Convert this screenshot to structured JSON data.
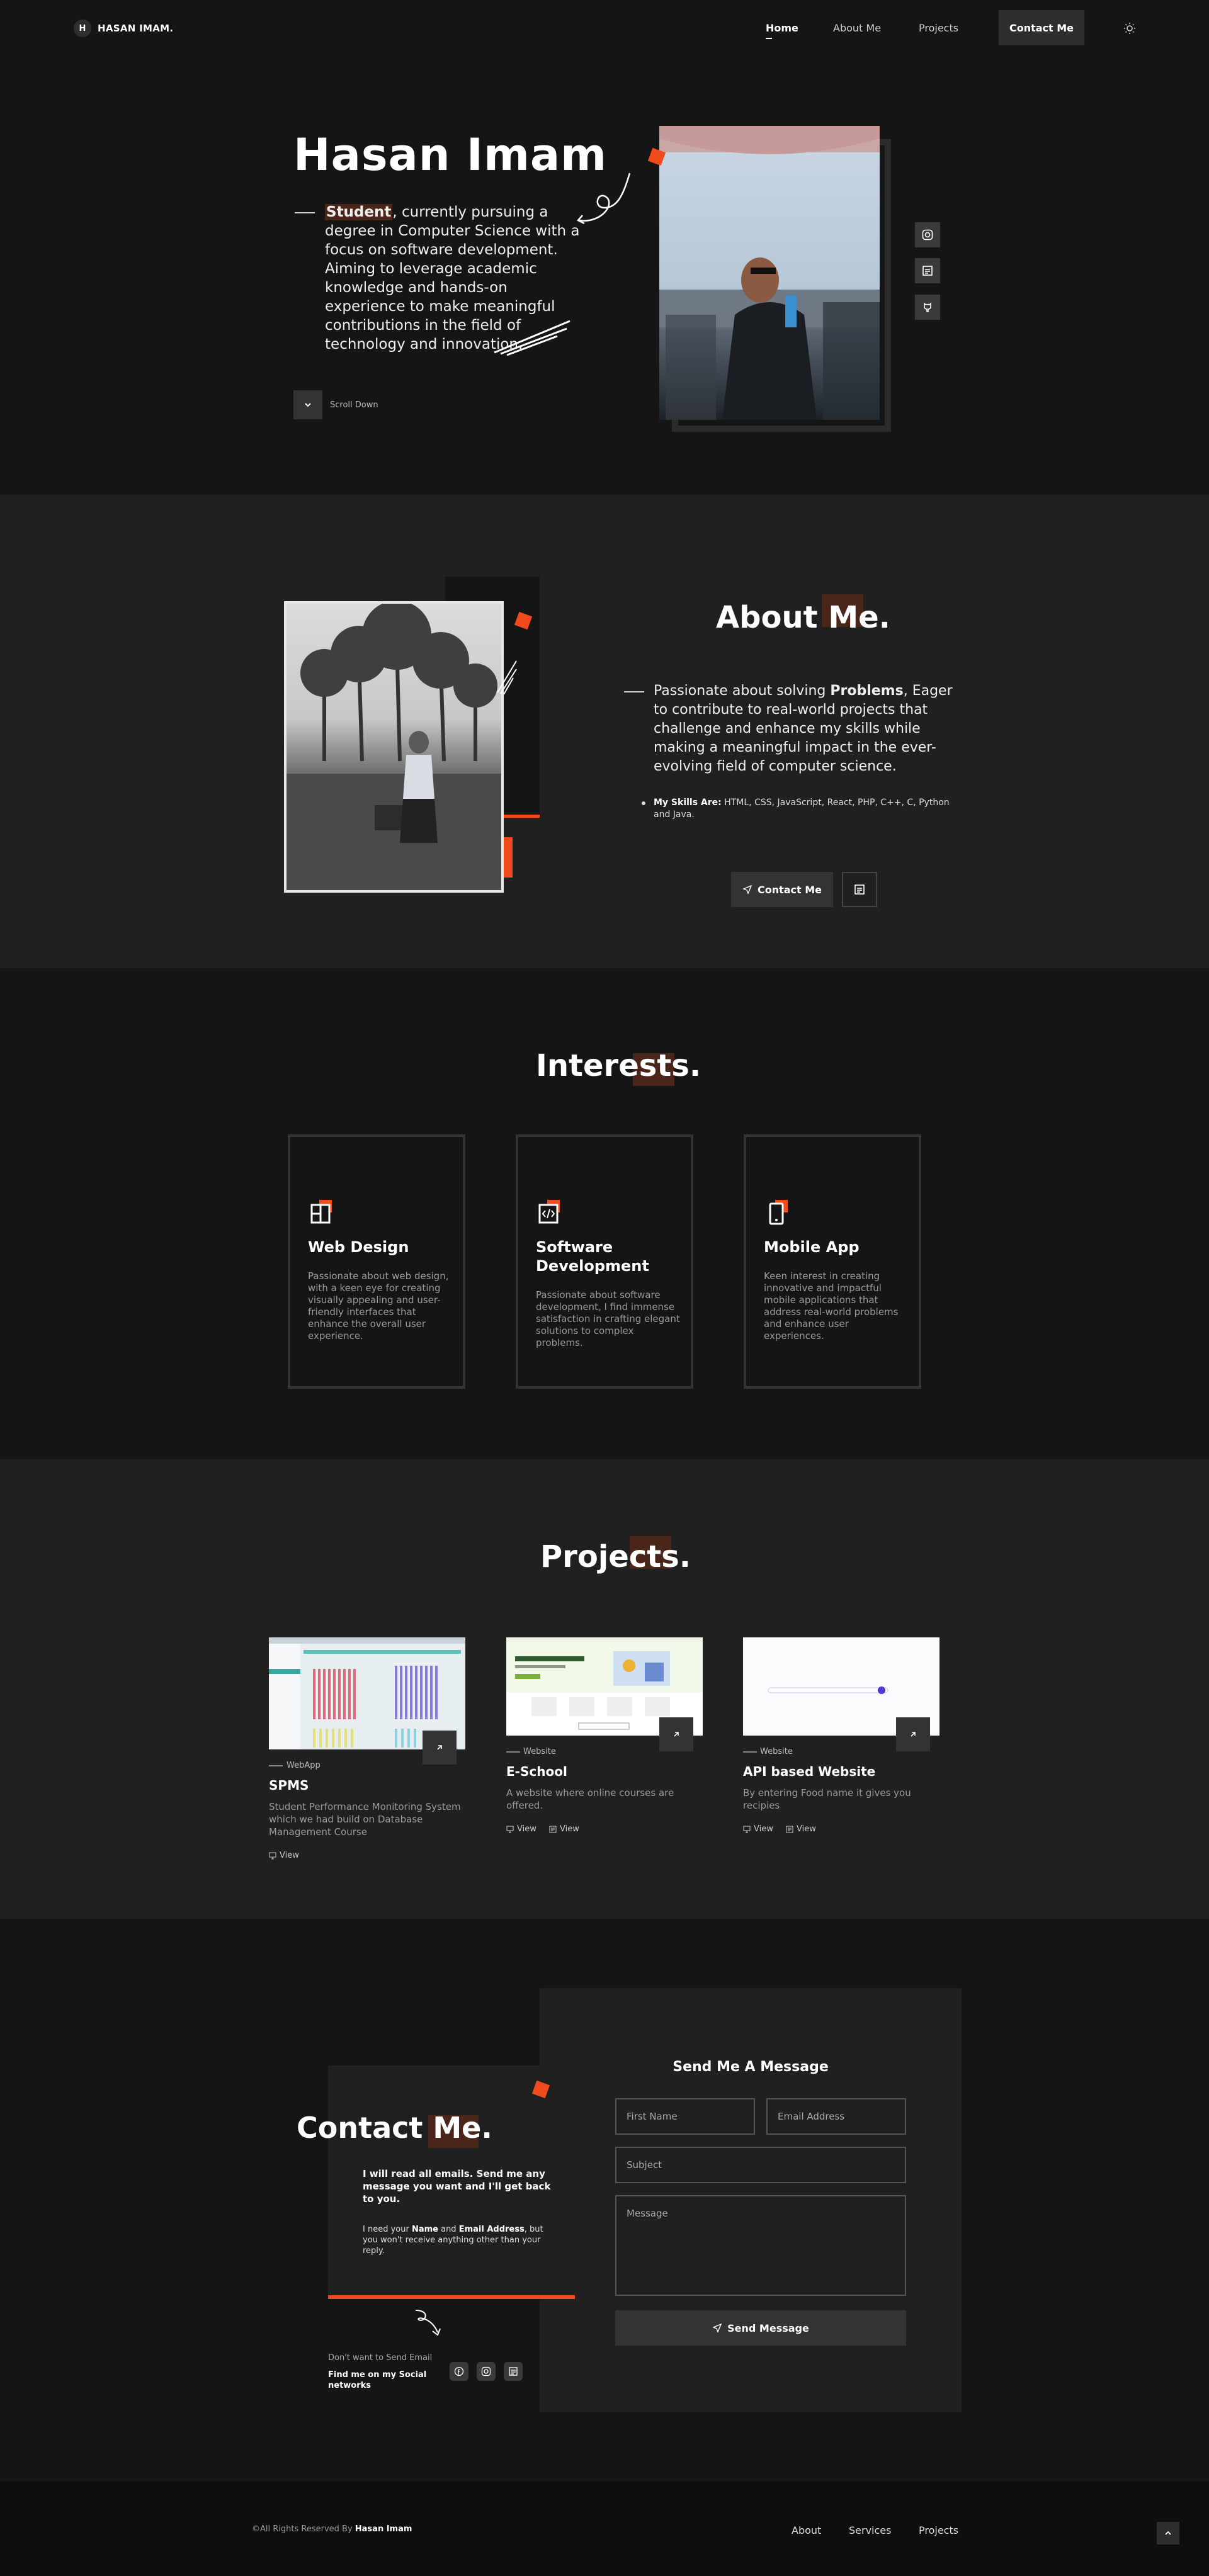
{
  "nav": {
    "logo_letter": "H",
    "logo_text": "HASAN IMAM.",
    "links": [
      "Home",
      "About Me",
      "Projects"
    ],
    "contact": "Contact Me"
  },
  "hero": {
    "name": "Hasan Imam",
    "highlight": "Student",
    "description": ", currently pursuing a degree in Computer Science with a focus on software development. Aiming to leverage academic knowledge and hands-on experience to make meaningful contributions in the field of technology and innovation.",
    "scroll": "Scroll Down"
  },
  "about": {
    "title": "About Me.",
    "text_before": "Passionate about solving ",
    "text_bold": "Problems",
    "text_after": ", Eager to contribute to real-world projects that challenge and enhance my skills while making a meaningful impact in the ever-evolving field of computer science.",
    "skills_label": "My Skills Are:",
    "skills": " HTML, CSS, JavaScript, React, PHP, C++, C, Python and Java.",
    "contact_btn": "Contact Me"
  },
  "interests": {
    "title": "Interests.",
    "cards": [
      {
        "title": "Web Design",
        "text": "Passionate about web design, with a keen eye for creating visually appealing and user-friendly interfaces that enhance the overall user experience.",
        "icon": "layout-icon"
      },
      {
        "title": "Software Development",
        "text": "Passionate about software development, I find immense satisfaction in crafting elegant solutions to complex problems.",
        "icon": "code-icon"
      },
      {
        "title": "Mobile App",
        "text": "Keen interest in creating innovative and impactful mobile applications that address real-world problems and enhance user experiences.",
        "icon": "mobile-icon"
      }
    ]
  },
  "projects": {
    "title": "Projects.",
    "items": [
      {
        "tag": "WebApp",
        "name": "SPMS",
        "desc": "Student Performance Monitoring System which we had build on Database Management Course",
        "links": [
          "View"
        ]
      },
      {
        "tag": "Website",
        "name": "E-School",
        "desc": "A website where online courses are offered.",
        "links": [
          "View",
          "View"
        ]
      },
      {
        "tag": "Website",
        "name": "API based Website",
        "desc": "By entering Food name it gives you recipies",
        "links": [
          "View",
          "View"
        ]
      }
    ]
  },
  "contact": {
    "title": "Contact Me.",
    "p1": "I will read all emails. Send me any message you want and I'll get back to you.",
    "p2_a": "I need your ",
    "p2_name": "Name",
    "p2_and": " and ",
    "p2_email": "Email Address",
    "p2_b": ", but you won't receive anything other than your reply.",
    "alt_text": "Don't want to Send Email",
    "alt_bold": "Find me on my Social networks",
    "form_title": "Send Me A Message",
    "first_name": "First Name",
    "email": "Email Address",
    "subject": "Subject",
    "message": "Message",
    "send": "Send Message"
  },
  "footer": {
    "copyright": "©All Rights Reserved By ",
    "owner": "Hasan Imam",
    "links": [
      "About",
      "Services",
      "Projects"
    ]
  },
  "colors": {
    "accent": "#f04a1d",
    "highlight": "#4a2519",
    "bg": "#151515",
    "bg_alt": "#202020"
  }
}
